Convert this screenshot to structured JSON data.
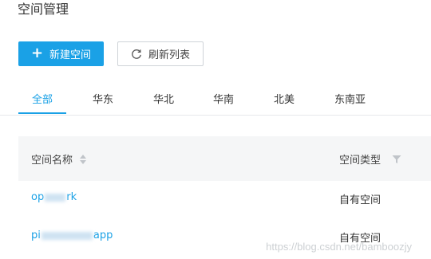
{
  "page": {
    "title": "空间管理"
  },
  "toolbar": {
    "new_button_label": "新建空间",
    "refresh_button_label": "刷新列表"
  },
  "tabs": [
    {
      "label": "全部",
      "active": true
    },
    {
      "label": "华东",
      "active": false
    },
    {
      "label": "华北",
      "active": false
    },
    {
      "label": "华南",
      "active": false
    },
    {
      "label": "北美",
      "active": false
    },
    {
      "label": "东南亚",
      "active": false
    }
  ],
  "table": {
    "columns": {
      "name": "空间名称",
      "type": "空间类型"
    },
    "rows": [
      {
        "name_prefix": "op",
        "name_suffix": "rk",
        "type": "自有空间"
      },
      {
        "name_prefix": "pi",
        "name_suffix": "app",
        "type": "自有空间"
      }
    ]
  },
  "watermark": "https://blog.csdn.net/bamboozjy",
  "colors": {
    "accent": "#1aa1e6",
    "header_bg": "#f5f6f7",
    "border": "#e6e8eb"
  }
}
